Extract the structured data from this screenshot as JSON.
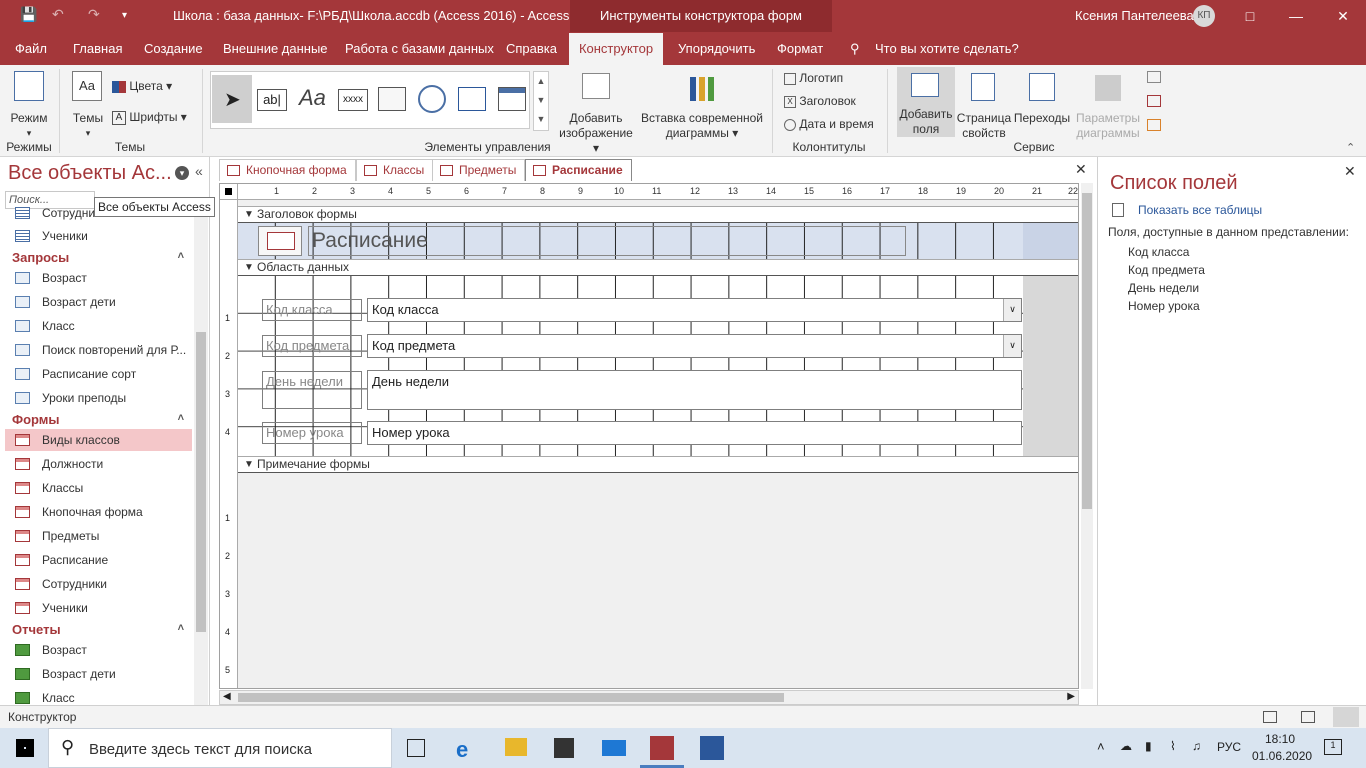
{
  "titlebar": {
    "title": "Школа : база данных- F:\\РБД\\Школа.accdb (Access 2016)  -  Access",
    "context_tools": "Инструменты конструктора форм",
    "user": "Ксения Пантелеева",
    "avatar": "КП"
  },
  "ribbon_tabs": [
    "Файл",
    "Главная",
    "Создание",
    "Внешние данные",
    "Работа с базами данных",
    "Справка",
    "Конструктор",
    "Упорядочить",
    "Формат"
  ],
  "tell_me": "Что вы хотите сделать?",
  "ribbon": {
    "mode_label": "Режим",
    "themes_label": "Темы",
    "colors_label": "Цвета",
    "fonts_label": "Шрифты",
    "group_modes": "Режимы",
    "group_themes": "Темы",
    "group_controls": "Элементы управления",
    "group_headers": "Колонтитулы",
    "group_service": "Сервис",
    "add_image": [
      "Добавить",
      "изображение"
    ],
    "insert_chart": [
      "Вставка современной",
      "диаграммы"
    ],
    "logo": "Логотип",
    "header": "Заголовок",
    "datetime": "Дата и время",
    "add_fields": [
      "Добавить",
      "поля"
    ],
    "property_sheet": [
      "Страница",
      "свойств"
    ],
    "transitions": "Переходы",
    "chart_params": [
      "Параметры",
      "диаграммы"
    ],
    "textbox_glyph": "ab|",
    "label_glyph": "Aa",
    "xxxx": "xxxx"
  },
  "nav": {
    "title": "Все объекты Ac...",
    "search_placeholder": "Поиск...",
    "tooltip": "Все объекты Access",
    "partial_item": "Сотрудни",
    "tables_tail": [
      "Ученики"
    ],
    "queries_label": "Запросы",
    "queries": [
      "Возраст",
      "Возраст дети",
      "Класс",
      "Поиск повторений для Р...",
      "Расписание сорт",
      "Уроки преподы"
    ],
    "forms_label": "Формы",
    "forms": [
      "Виды классов",
      "Должности",
      "Классы",
      "Кнопочная форма",
      "Предметы",
      "Расписание",
      "Сотрудники",
      "Ученики"
    ],
    "reports_label": "Отчеты",
    "reports": [
      "Возраст",
      "Возраст дети",
      "Класс"
    ]
  },
  "doc_tabs": [
    "Кнопочная форма",
    "Классы",
    "Предметы",
    "Расписание"
  ],
  "design": {
    "header_section": "Заголовок формы",
    "detail_section": "Область данных",
    "footer_section": "Примечание формы",
    "form_title": "Расписание",
    "ruler": [
      "1",
      "2",
      "3",
      "4",
      "5",
      "6",
      "7",
      "8",
      "9",
      "10",
      "11",
      "12",
      "13",
      "14",
      "15",
      "16",
      "17",
      "18",
      "19",
      "20",
      "21",
      "22"
    ],
    "vruler": [
      "1",
      "2",
      "3",
      "4"
    ],
    "vruler_footer": [
      "1",
      "2",
      "3",
      "4",
      "5"
    ],
    "fields": [
      {
        "label": "Код класса",
        "value": "Код класса"
      },
      {
        "label": "Код предмета",
        "value": "Код предмета"
      },
      {
        "label": "День недели",
        "value": "День недели"
      },
      {
        "label": "Номер урока",
        "value": "Номер урока"
      }
    ]
  },
  "field_list": {
    "title": "Список полей",
    "show_all": "Показать все таблицы",
    "available": "Поля, доступные в данном представлении:",
    "fields": [
      "Код класса",
      "Код предмета",
      "День недели",
      "Номер урока"
    ]
  },
  "status": "Конструктор",
  "taskbar": {
    "search": "Введите здесь текст для поиска",
    "lang": "РУС",
    "time": "18:10",
    "date": "01.06.2020",
    "notif": "1"
  },
  "colors": {
    "accent": "#a4373a",
    "highlight": "#f4c7c9"
  }
}
